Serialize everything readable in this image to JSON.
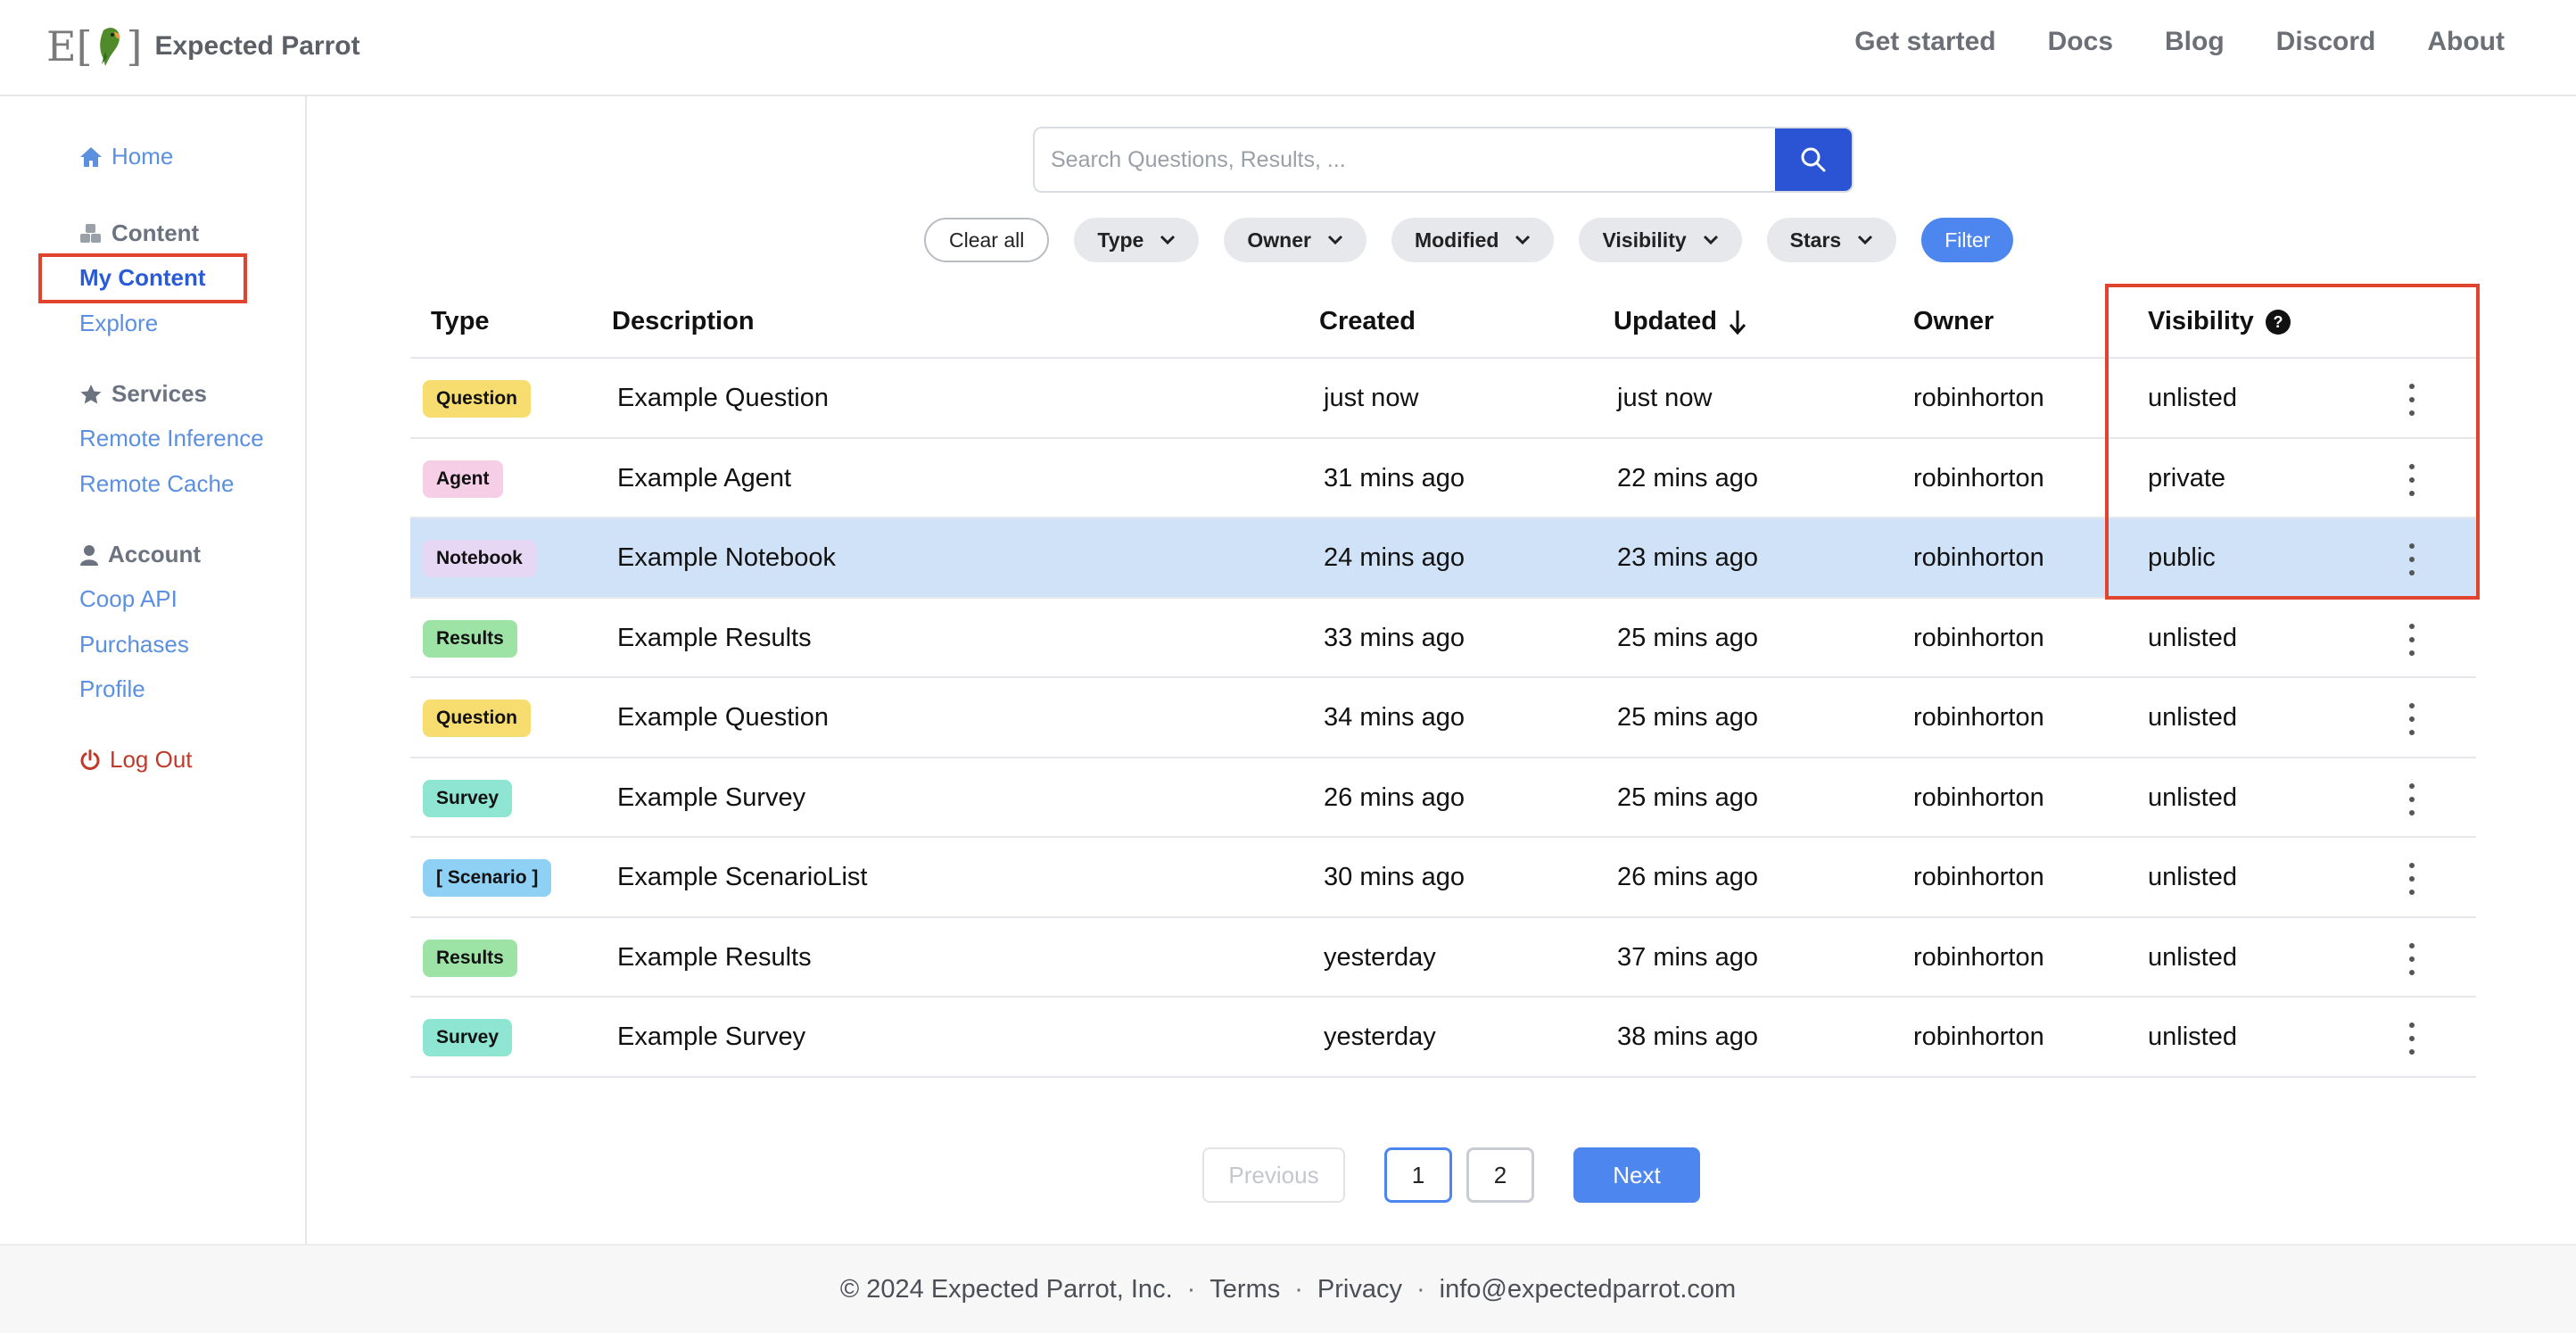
{
  "brand": {
    "logo_text_left": "E[",
    "logo_text_right": "]",
    "name": "Expected Parrot"
  },
  "nav": [
    "Get started",
    "Docs",
    "Blog",
    "Discord",
    "About"
  ],
  "sidebar": {
    "home": "Home",
    "content_head": "Content",
    "my_content": "My Content",
    "explore": "Explore",
    "services_head": "Services",
    "remote_inference": "Remote Inference",
    "remote_cache": "Remote Cache",
    "account_head": "Account",
    "coop_api": "Coop API",
    "purchases": "Purchases",
    "profile": "Profile",
    "logout": "Log Out"
  },
  "search": {
    "placeholder": "Search Questions, Results, ...",
    "value": ""
  },
  "filters": {
    "clear": "Clear all",
    "type": "Type",
    "owner": "Owner",
    "modified": "Modified",
    "visibility": "Visibility",
    "stars": "Stars",
    "filter": "Filter"
  },
  "table": {
    "headers": {
      "type": "Type",
      "description": "Description",
      "created": "Created",
      "updated": "Updated",
      "owner": "Owner",
      "visibility": "Visibility"
    },
    "rows": [
      {
        "type": "Question",
        "type_color": "#f7dc6f",
        "description": "Example Question",
        "created": "just now",
        "updated": "just now",
        "owner": "robinhorton",
        "visibility": "unlisted"
      },
      {
        "type": "Agent",
        "type_color": "#f6cfe6",
        "description": "Example Agent",
        "created": "31 mins ago",
        "updated": "22 mins ago",
        "owner": "robinhorton",
        "visibility": "private"
      },
      {
        "type": "Notebook",
        "type_color": "#e6d7f5",
        "description": "Example Notebook",
        "created": "24 mins ago",
        "updated": "23 mins ago",
        "owner": "robinhorton",
        "visibility": "public"
      },
      {
        "type": "Results",
        "type_color": "#9ee3a6",
        "description": "Example Results",
        "created": "33 mins ago",
        "updated": "25 mins ago",
        "owner": "robinhorton",
        "visibility": "unlisted"
      },
      {
        "type": "Question",
        "type_color": "#f7dc6f",
        "description": "Example Question",
        "created": "34 mins ago",
        "updated": "25 mins ago",
        "owner": "robinhorton",
        "visibility": "unlisted"
      },
      {
        "type": "Survey",
        "type_color": "#8ee6d2",
        "description": "Example Survey",
        "created": "26 mins ago",
        "updated": "25 mins ago",
        "owner": "robinhorton",
        "visibility": "unlisted"
      },
      {
        "type": "[ Scenario ]",
        "type_color": "#8fd0f5",
        "description": "Example ScenarioList",
        "created": "30 mins ago",
        "updated": "26 mins ago",
        "owner": "robinhorton",
        "visibility": "unlisted"
      },
      {
        "type": "Results",
        "type_color": "#9ee3a6",
        "description": "Example Results",
        "created": "yesterday",
        "updated": "37 mins ago",
        "owner": "robinhorton",
        "visibility": "unlisted"
      },
      {
        "type": "Survey",
        "type_color": "#8ee6d2",
        "description": "Example Survey",
        "created": "yesterday",
        "updated": "38 mins ago",
        "owner": "robinhorton",
        "visibility": "unlisted"
      }
    ]
  },
  "pagination": {
    "previous": "Previous",
    "pages": [
      "1",
      "2"
    ],
    "current": "1",
    "next": "Next"
  },
  "footer": {
    "copyright": "© 2024 Expected Parrot, Inc.",
    "terms": "Terms",
    "privacy": "Privacy",
    "email": "info@expectedparrot.com",
    "separator": "·"
  },
  "colors": {
    "accent": "#4d86ef",
    "search_button": "#2a54d4",
    "selected_row": "#cfe2f7",
    "highlight_box": "#e0432e",
    "link": "#5b8fe0",
    "logout": "#c0392b"
  }
}
